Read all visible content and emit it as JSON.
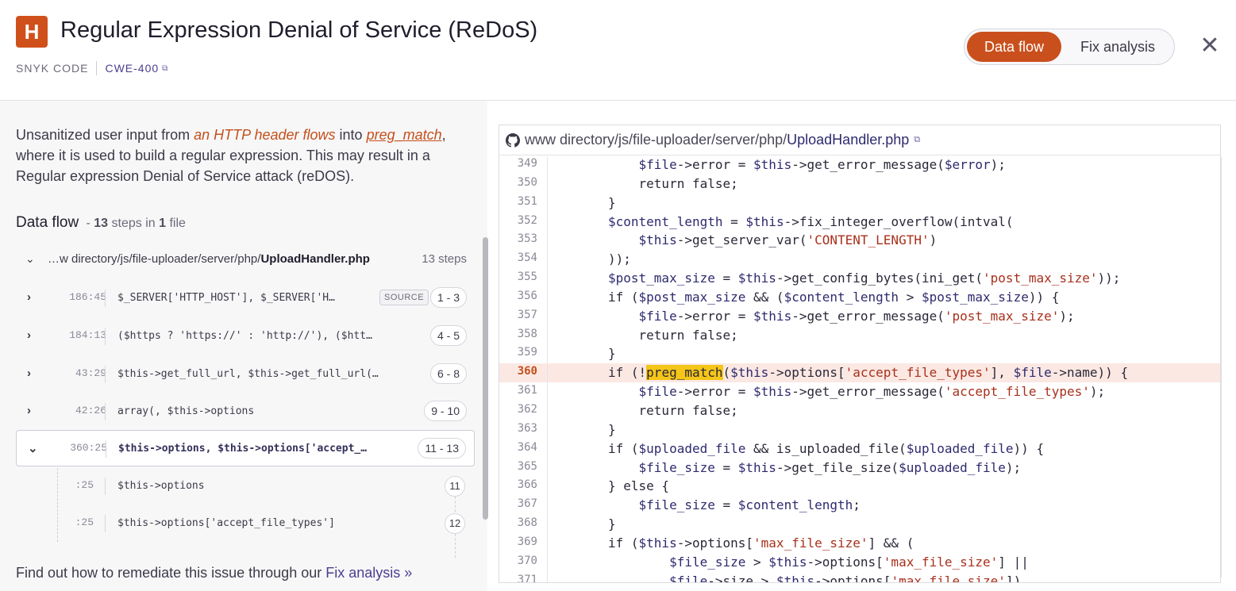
{
  "header": {
    "severity_letter": "H",
    "title": "Regular Expression Denial of Service (ReDoS)",
    "source_label": "SNYK CODE",
    "cwe": "CWE-400",
    "tabs": [
      "Data flow",
      "Fix analysis"
    ],
    "active_tab": "Data flow",
    "close": "✕"
  },
  "description": {
    "p1": "Unsanitized user input from ",
    "source": "an HTTP header flows",
    "p2": " into ",
    "sink": "preg_match",
    "p3": ", where it is used to build a regular expression. This may result in a Regular expression Denial of Service attack (reDOS)."
  },
  "dataflow": {
    "title": "Data flow",
    "steps_prefix": "- ",
    "steps_count": "13",
    "steps_mid": " steps in ",
    "files_count": "1",
    "files_suffix": " file",
    "file_path_prefix": "…w directory/js/file-uploader/server/php/",
    "file_name": "UploadHandler.php",
    "file_steps": "13 steps",
    "steps": [
      {
        "loc": "186:45",
        "code": "$_SERVER['HTTP_HOST'], $_SERVER['H…",
        "badge": "SOURCE",
        "range": "1 - 3"
      },
      {
        "loc": "184:13",
        "code": "($https ? 'https://' : 'http://'), ($htt…",
        "badge": "",
        "range": "4 - 5"
      },
      {
        "loc": "43:29",
        "code": "$this->get_full_url, $this->get_full_url(…",
        "badge": "",
        "range": "6 - 8"
      },
      {
        "loc": "42:26",
        "code": "array(, $this->options",
        "badge": "",
        "range": "9 - 10"
      },
      {
        "loc": "360:25",
        "code": "$this->options, $this->options['accept_…",
        "badge": "",
        "range": "11 - 13"
      }
    ],
    "substeps": [
      {
        "loc": ":25",
        "code": "$this->options",
        "num": "11"
      },
      {
        "loc": ":25",
        "code": "$this->options['accept_file_types']",
        "num": "12"
      }
    ],
    "footer_text": "Find out how to remediate this issue through our ",
    "footer_link": "Fix analysis »"
  },
  "code": {
    "path_prefix": "www directory/js/file-uploader/server/php/",
    "file": "UploadHandler.php",
    "highlight_line": 360,
    "lines": [
      {
        "n": "349",
        "t": "    $file->error = $this->get_error_message($error);"
      },
      {
        "n": "350",
        "t": "    return false;"
      },
      {
        "n": "351",
        "t": "}"
      },
      {
        "n": "352",
        "t": "$content_length = $this->fix_integer_overflow(intval("
      },
      {
        "n": "353",
        "t": "    $this->get_server_var('CONTENT_LENGTH')"
      },
      {
        "n": "354",
        "t": "));"
      },
      {
        "n": "355",
        "t": "$post_max_size = $this->get_config_bytes(ini_get('post_max_size'));"
      },
      {
        "n": "356",
        "t": "if ($post_max_size && ($content_length > $post_max_size)) {"
      },
      {
        "n": "357",
        "t": "    $file->error = $this->get_error_message('post_max_size');"
      },
      {
        "n": "358",
        "t": "    return false;"
      },
      {
        "n": "359",
        "t": "}"
      },
      {
        "n": "360",
        "t": "if (!preg_match($this->options['accept_file_types'], $file->name)) {"
      },
      {
        "n": "361",
        "t": "    $file->error = $this->get_error_message('accept_file_types');"
      },
      {
        "n": "362",
        "t": "    return false;"
      },
      {
        "n": "363",
        "t": "}"
      },
      {
        "n": "364",
        "t": "if ($uploaded_file && is_uploaded_file($uploaded_file)) {"
      },
      {
        "n": "365",
        "t": "    $file_size = $this->get_file_size($uploaded_file);"
      },
      {
        "n": "366",
        "t": "} else {"
      },
      {
        "n": "367",
        "t": "    $file_size = $content_length;"
      },
      {
        "n": "368",
        "t": "}"
      },
      {
        "n": "369",
        "t": "if ($this->options['max_file_size'] && ("
      },
      {
        "n": "370",
        "t": "        $file_size > $this->options['max_file_size'] ||"
      },
      {
        "n": "371",
        "t": "        $file->size > $this->options['max_file_size'])"
      }
    ]
  },
  "colors": {
    "accent": "#c9501c",
    "link": "#4a3f8f",
    "highlight": "#fbe8e3",
    "mark": "#f5c518"
  }
}
